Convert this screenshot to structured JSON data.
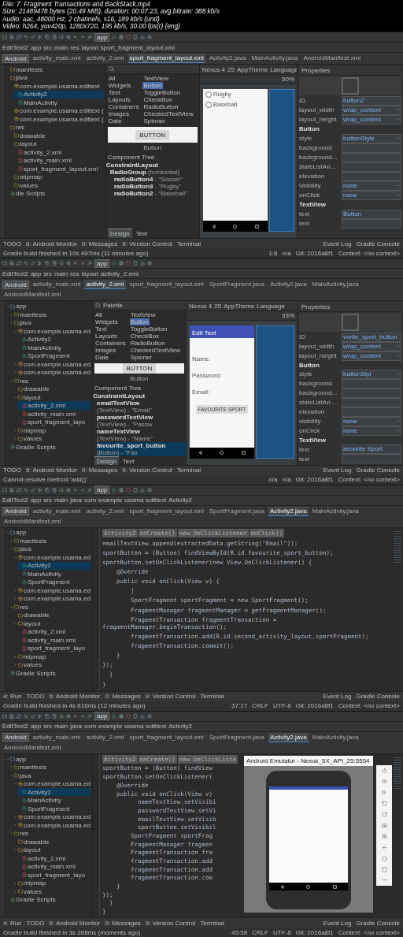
{
  "header": {
    "lines": [
      "File: 7. Fragment Transactions and BackStack.mp4",
      "Size: 21489478 bytes (20.49 MiB), duration: 00:07:23, avg.bitrate: 388 kb/s",
      "Audio: aac, 48000 Hz, 2 channels, s16, 189 kb/s (und)",
      "Video: h264, yuv420p, 1280x720, 195 kb/s, 30.00 fps(r) (eng)"
    ]
  },
  "frames": [
    {
      "kind": "designer",
      "run_config": "app",
      "breadcrumbs": [
        "EditText2",
        "app",
        "src",
        "main",
        "res",
        "layout",
        "sport_fragment_layout.xml"
      ],
      "view_mode": "Android",
      "tabs": [
        {
          "label": "activity_main.xml",
          "selected": false
        },
        {
          "label": "activity_2.xml",
          "selected": false
        },
        {
          "label": "sport_fragment_layout.xml",
          "selected": true
        },
        {
          "label": "Activity2.java",
          "selected": false
        },
        {
          "label": "MainActivity.java",
          "selected": false
        },
        {
          "label": "AndroidManifest.xml",
          "selected": false
        }
      ],
      "tree": [
        {
          "label": "manifests",
          "kind": "folder",
          "selected": false
        },
        {
          "label": "java",
          "kind": "folder",
          "selected": false,
          "children": [
            {
              "label": "com.example.usama.edittext",
              "kind": "package",
              "selected": false,
              "children": [
                {
                  "label": "Activity2",
                  "kind": "class",
                  "selected": true
                },
                {
                  "label": "MainActivity",
                  "kind": "class",
                  "selected": false
                }
              ]
            },
            {
              "label": "com.example.usama.edittext (",
              "kind": "package",
              "selected": false
            },
            {
              "label": "com.example.usama.edittext (",
              "kind": "package",
              "selected": false
            }
          ]
        },
        {
          "label": "res",
          "kind": "folder",
          "selected": false,
          "children": [
            {
              "label": "drawable",
              "kind": "folder",
              "selected": false
            },
            {
              "label": "layout",
              "kind": "folder",
              "selected": false,
              "children": [
                {
                  "label": "activity_2.xml",
                  "kind": "xml",
                  "selected": false
                },
                {
                  "label": "activity_main.xml",
                  "kind": "xml",
                  "selected": false
                },
                {
                  "label": "sport_fragment_layout.xml",
                  "kind": "xml",
                  "selected": false
                }
              ]
            },
            {
              "label": "mipmap",
              "kind": "folder",
              "selected": false
            },
            {
              "label": "values",
              "kind": "folder",
              "selected": false
            }
          ]
        },
        {
          "label": "dle Scripts",
          "kind": "gradle",
          "selected": false
        }
      ],
      "palette": {
        "categories": [
          "All",
          "Widgets",
          "Text",
          "Layouts",
          "Containers",
          "Images",
          "Date"
        ],
        "widgets": [
          {
            "label": "TextView",
            "selected": false
          },
          {
            "label": "Button",
            "selected": true
          },
          {
            "label": "ToggleButton",
            "selected": false
          },
          {
            "label": "CheckBox",
            "selected": false
          },
          {
            "label": "RadioButton",
            "selected": false
          },
          {
            "label": "CheckedTextView",
            "selected": false
          },
          {
            "label": "Spinner",
            "selected": false
          }
        ],
        "preview": "BUTTON",
        "caption": "Button"
      },
      "component_tree": {
        "title": "Component Tree",
        "nodes": [
          {
            "id": "ConstraintLayout",
            "selected": false,
            "children": [
              {
                "id": "RadioGroup",
                "detail": "(horizontal)",
                "selected": false,
                "children": [
                  {
                    "id": "radioButton4",
                    "detail": "- \"Soccer\"",
                    "selected": false
                  },
                  {
                    "id": "radioButton3",
                    "detail": "- \"Rugby\"",
                    "selected": false
                  },
                  {
                    "id": "radioButton2",
                    "detail": "- \"Baseball\"",
                    "selected": false
                  }
                ]
              }
            ]
          }
        ]
      },
      "design_tabs": [
        {
          "label": "Design",
          "selected": true
        },
        {
          "label": "Text",
          "selected": false
        }
      ],
      "canvas_toolbar": [
        "Nexus 4",
        "25",
        "AppTheme",
        "Language"
      ],
      "zoom": "50%",
      "screen": {
        "kind": "radios",
        "items": [
          {
            "label": "Rugby",
            "checked": false
          },
          {
            "label": "Baseball",
            "checked": false
          }
        ]
      },
      "properties_title": "Properties",
      "properties": [
        {
          "kind": "field",
          "label": "ID",
          "value": "button2"
        },
        {
          "kind": "dropdown",
          "label": "layout_width",
          "value": "wrap_content"
        },
        {
          "kind": "dropdown",
          "label": "layout_height",
          "value": "wrap_content"
        },
        {
          "kind": "header",
          "label": "Button"
        },
        {
          "kind": "dropdown",
          "label": "style",
          "value": "buttonStyle"
        },
        {
          "kind": "field",
          "label": "background"
        },
        {
          "kind": "field",
          "label": "background..."
        },
        {
          "kind": "field",
          "label": "stateListAn..."
        },
        {
          "kind": "field",
          "label": "elevation"
        },
        {
          "kind": "dropdown",
          "label": "visibility",
          "value": "none"
        },
        {
          "kind": "dropdown",
          "label": "onClick",
          "value": "none"
        },
        {
          "kind": "header",
          "label": "TextView"
        },
        {
          "kind": "field",
          "label": "text",
          "value": "Button"
        },
        {
          "kind": "field",
          "label": "text"
        }
      ],
      "tool_windows": [
        "TODO",
        "6: Android Monitor",
        "0: Messages",
        "9: Version Control",
        "Terminal"
      ],
      "tool_windows_right": [
        "Event Log",
        "Gradle Console"
      ],
      "status": {
        "message": "Gradle build finished in 10s 497ms (11 minutes ago)",
        "info": [
          "1:8",
          "n/a",
          "Git: 2016a8f1",
          "Context: <no context>"
        ]
      }
    },
    {
      "kind": "designer",
      "run_config": "app",
      "breadcrumbs": [
        "EditText2",
        "app",
        "src",
        "main",
        "res",
        "layout",
        "activity_2.xml"
      ],
      "view_mode": "Android",
      "tabs": [
        {
          "label": "activity_main.xml",
          "selected": false
        },
        {
          "label": "activity_2.xml",
          "selected": true
        },
        {
          "label": "sport_fragment_layout.xml",
          "selected": false
        },
        {
          "label": "SportFragment.java",
          "selected": false
        },
        {
          "label": "Activity2.java",
          "selected": false
        },
        {
          "label": "MainActivity.java",
          "selected": false
        },
        {
          "label": "AndroidManifest.xml",
          "selected": false
        }
      ],
      "tree": [
        {
          "label": "app",
          "kind": "module",
          "selected": false,
          "expanded": true,
          "children": [
            {
              "label": "manifests",
              "kind": "folder",
              "selected": false,
              "expanded": false
            },
            {
              "label": "java",
              "kind": "folder",
              "selected": false,
              "expanded": true,
              "children": [
                {
                  "label": "com.example.usama.ed",
                  "kind": "package",
                  "selected": false,
                  "expanded": true,
                  "children": [
                    {
                      "label": "Activity2",
                      "kind": "class",
                      "selected": false
                    },
                    {
                      "label": "MainActivity",
                      "kind": "class",
                      "selected": false
                    },
                    {
                      "label": "SportFragment",
                      "kind": "class",
                      "selected": false
                    }
                  ]
                },
                {
                  "label": "com.example.usama.ed",
                  "kind": "package",
                  "selected": false,
                  "expanded": false
                },
                {
                  "label": "com.example.usama.ed",
                  "kind": "package",
                  "selected": false,
                  "expanded": false
                }
              ]
            },
            {
              "label": "res",
              "kind": "folder",
              "selected": false,
              "expanded": true,
              "children": [
                {
                  "label": "drawable",
                  "kind": "folder",
                  "selected": false
                },
                {
                  "label": "layout",
                  "kind": "folder",
                  "selected": false,
                  "expanded": true,
                  "children": [
                    {
                      "label": "activity_2.xml",
                      "kind": "xml",
                      "selected": true
                    },
                    {
                      "label": "activity_main.xml",
                      "kind": "xml",
                      "selected": false
                    },
                    {
                      "label": "sport_fragment_layo",
                      "kind": "xml",
                      "selected": false
                    }
                  ]
                },
                {
                  "label": "mipmap",
                  "kind": "folder",
                  "selected": false,
                  "expanded": false
                },
                {
                  "label": "values",
                  "kind": "folder",
                  "selected": false,
                  "expanded": false
                }
              ]
            }
          ]
        },
        {
          "label": "Gradle Scripts",
          "kind": "gradle",
          "selected": false
        }
      ],
      "palette": {
        "title": "Palette",
        "categories": [
          "All",
          "Widgets",
          "Text",
          "Layouts",
          "Containers",
          "Images",
          "Date"
        ],
        "widgets": [
          {
            "label": "TextView",
            "selected": false
          },
          {
            "label": "Button",
            "selected": true
          },
          {
            "label": "ToggleButton",
            "selected": false
          },
          {
            "label": "CheckBox",
            "selected": false
          },
          {
            "label": "RadioButton",
            "selected": false
          },
          {
            "label": "CheckedTextView",
            "selected": false
          },
          {
            "label": "Spinner",
            "selected": false
          }
        ],
        "preview": "BUTTON",
        "caption": "Button"
      },
      "component_tree": {
        "title": "Component Tree",
        "nodes": [
          {
            "id": "ConstraintLayout",
            "selected": false,
            "children": [
              {
                "id": "emailTextView",
                "detail": "(TextView) - \"Email\"",
                "selected": false
              },
              {
                "id": "passwordTextView",
                "detail": "(TextView) - \"Passw",
                "selected": false
              },
              {
                "id": "nameTextView",
                "detail": "(TextView) - \"Name\"",
                "selected": false
              },
              {
                "id": "favourite_sport_button",
                "detail": "(Button) - \"Fav",
                "selected": true
              }
            ]
          }
        ]
      },
      "design_tabs": [
        {
          "label": "Design",
          "selected": true
        },
        {
          "label": "Text",
          "selected": false
        }
      ],
      "canvas_toolbar": [
        "Nexus 4",
        "25",
        "AppTheme",
        "Language"
      ],
      "zoom": "33%",
      "screen": {
        "kind": "form",
        "app_title": "Edit Text",
        "labels": [
          "Name:",
          "Password:",
          "Email:"
        ],
        "button": "FAVOURITE SPORT"
      },
      "properties_title": "Properties",
      "properties": [
        {
          "kind": "field",
          "label": "ID",
          "value": "vorite_sport_button"
        },
        {
          "kind": "dropdown",
          "label": "layout_width",
          "value": "wrap_content"
        },
        {
          "kind": "dropdown",
          "label": "layout_height",
          "value": "wrap_content"
        },
        {
          "kind": "header",
          "label": "Button"
        },
        {
          "kind": "dropdown",
          "label": "style",
          "value": "buttonStyl"
        },
        {
          "kind": "field",
          "label": "background"
        },
        {
          "kind": "field",
          "label": "background..."
        },
        {
          "kind": "field",
          "label": "stateListAn..."
        },
        {
          "kind": "field",
          "label": "elevation"
        },
        {
          "kind": "dropdown",
          "label": "visibility",
          "value": "none"
        },
        {
          "kind": "dropdown",
          "label": "onClick",
          "value": "none"
        },
        {
          "kind": "header",
          "label": "TextView"
        },
        {
          "kind": "field",
          "label": "text",
          "value": "avourite Sport"
        },
        {
          "kind": "field",
          "label": "text"
        }
      ],
      "tool_windows": [
        "TODO",
        "6: Android Monitor",
        "0: Messages",
        "9: Version Control",
        "Terminal"
      ],
      "tool_windows_right": [
        "Event Log",
        "Gradle Console"
      ],
      "status": {
        "message": "Cannot resolve method 'add()'",
        "info": [
          "n/a",
          "n/a",
          "Git: 2016a8f1",
          "Context: <no context>"
        ]
      }
    },
    {
      "kind": "code",
      "run_config": "app",
      "breadcrumbs": [
        "EditText2",
        "app",
        "src",
        "main",
        "java",
        "com",
        "example",
        "usama",
        "edittext",
        "Activity2"
      ],
      "view_mode": "Android",
      "tabs": [
        {
          "label": "activity_main.xml",
          "selected": false
        },
        {
          "label": "activity_2.xml",
          "selected": false
        },
        {
          "label": "sport_fragment_layout.xml",
          "selected": false
        },
        {
          "label": "SportFragment.java",
          "selected": false
        },
        {
          "label": "Activity2.java",
          "selected": true
        },
        {
          "label": "MainActivity.java",
          "selected": false
        },
        {
          "label": "AndroidManifest.xml",
          "selected": false
        }
      ],
      "tree": [
        {
          "label": "app",
          "kind": "module",
          "selected": false,
          "expanded": true,
          "children": [
            {
              "label": "manifests",
              "kind": "folder",
              "selected": false,
              "expanded": false
            },
            {
              "label": "java",
              "kind": "folder",
              "selected": false,
              "expanded": true,
              "children": [
                {
                  "label": "com.example.usama.ed",
                  "kind": "package",
                  "selected": false,
                  "expanded": true,
                  "children": [
                    {
                      "label": "Activity2",
                      "kind": "class",
                      "selected": true
                    },
                    {
                      "label": "MainActivity",
                      "kind": "class",
                      "selected": false
                    },
                    {
                      "label": "SportFragment",
                      "kind": "class",
                      "selected": false
                    }
                  ]
                },
                {
                  "label": "com.example.usama.ed",
                  "kind": "package",
                  "selected": false,
                  "expanded": false
                },
                {
                  "label": "com.example.usama.ed",
                  "kind": "package",
                  "selected": false,
                  "expanded": false
                }
              ]
            },
            {
              "label": "res",
              "kind": "folder",
              "selected": false,
              "expanded": true,
              "children": [
                {
                  "label": "drawable",
                  "kind": "folder",
                  "selected": false
                },
                {
                  "label": "layout",
                  "kind": "folder",
                  "selected": false,
                  "expanded": true,
                  "children": [
                    {
                      "label": "activity_2.xml",
                      "kind": "xml",
                      "selected": false
                    },
                    {
                      "label": "activity_main.xml",
                      "kind": "xml",
                      "selected": false
                    },
                    {
                      "label": "sport_fragment_layo",
                      "kind": "xml",
                      "selected": false
                    }
                  ]
                },
                {
                  "label": "mipmap",
                  "kind": "folder",
                  "selected": false,
                  "expanded": false
                },
                {
                  "label": "values",
                  "kind": "folder",
                  "selected": false,
                  "expanded": false
                }
              ]
            }
          ]
        },
        {
          "label": "Gradle Scripts",
          "kind": "gradle",
          "selected": false
        }
      ],
      "code_path": [
        "Activity2",
        "onCreate()",
        "new OnClickListener",
        "onClick()"
      ],
      "code": [
        "emailTextView.append(extractedData.getString(\"Email\"));",
        "sportButton = (Button) findViewById(R.id.favourite_sport_button);",
        "sportButton.setOnClickListener(new View.OnClickListener() {",
        "    @Override",
        "    public void onClick(View v) {",
        "        |",
        "        SportFragment sportFragment = new SportFragment();",
        "        FragmentManager fragmentManager = getFragmentManager();",
        "        FragmentTransaction fragmentTransaction = fragmentManager.beginTransaction();",
        "        fragmentTransaction.add(R.id.second_activity_layout,sportFragment);",
        "        fragmentTransaction.commit();",
        "    }",
        "});",
        "  }",
        "}"
      ],
      "tool_windows": [
        "4: Run",
        "TODO",
        "6: Android Monitor",
        "0: Messages",
        "9: Version Control",
        "Terminal"
      ],
      "tool_windows_right": [
        "Event Log",
        "Gradle Console"
      ],
      "status": {
        "message": "Gradle build finished in 4s 616ms (12 minutes ago)",
        "info": [
          "37:17",
          "CRLF",
          "UTF-8",
          "Git: 2016a8f1",
          "Context: <no context>"
        ]
      }
    },
    {
      "kind": "code",
      "run_config": "app",
      "breadcrumbs": [
        "EditText2",
        "app",
        "src",
        "main",
        "java",
        "com",
        "example",
        "usama",
        "edittext",
        "Activity2"
      ],
      "view_mode": "Android",
      "tabs": [
        {
          "label": "activity_main.xml",
          "selected": false
        },
        {
          "label": "activity_2.xml",
          "selected": false
        },
        {
          "label": "sport_fragment_layout.xml",
          "selected": false
        },
        {
          "label": "SportFragment.java",
          "selected": false
        },
        {
          "label": "Activity2.java",
          "selected": true
        },
        {
          "label": "MainActivity.java",
          "selected": false
        },
        {
          "label": "AndroidManifest.xml",
          "selected": false
        }
      ],
      "tree": [
        {
          "label": "app",
          "kind": "module",
          "selected": false,
          "expanded": true,
          "children": [
            {
              "label": "manifests",
              "kind": "folder",
              "selected": false,
              "expanded": false
            },
            {
              "label": "java",
              "kind": "folder",
              "selected": false,
              "expanded": true,
              "children": [
                {
                  "label": "com.example.usama.ed",
                  "kind": "package",
                  "selected": false,
                  "expanded": true,
                  "children": [
                    {
                      "label": "Activity2",
                      "kind": "class",
                      "selected": true
                    },
                    {
                      "label": "MainActivity",
                      "kind": "class",
                      "selected": false
                    },
                    {
                      "label": "SportFragment",
                      "kind": "class",
                      "selected": false
                    }
                  ]
                },
                {
                  "label": "com.example.usama.ed",
                  "kind": "package",
                  "selected": false,
                  "expanded": false
                },
                {
                  "label": "com.example.usama.ed",
                  "kind": "package",
                  "selected": false,
                  "expanded": false
                }
              ]
            },
            {
              "label": "res",
              "kind": "folder",
              "selected": false,
              "expanded": true,
              "children": [
                {
                  "label": "drawable",
                  "kind": "folder",
                  "selected": false
                },
                {
                  "label": "layout",
                  "kind": "folder",
                  "selected": false,
                  "expanded": true,
                  "children": [
                    {
                      "label": "activity_2.xml",
                      "kind": "xml",
                      "selected": false
                    },
                    {
                      "label": "activity_main.xml",
                      "kind": "xml",
                      "selected": false
                    },
                    {
                      "label": "sport_fragment_layo",
                      "kind": "xml",
                      "selected": false
                    }
                  ]
                },
                {
                  "label": "mipmap",
                  "kind": "folder",
                  "selected": false,
                  "expanded": false
                },
                {
                  "label": "values",
                  "kind": "folder",
                  "selected": false,
                  "expanded": false
                }
              ]
            }
          ]
        },
        {
          "label": "Gradle Scripts",
          "kind": "gradle",
          "selected": false
        }
      ],
      "code_path": [
        "Activity2",
        "onCreate()",
        "new OnClickListe"
      ],
      "code": [
        "sportButton = (Button) findView",
        "sportButton.setOnClickListener(",
        "    @Override",
        "    public void onClick(View v)",
        "          nameTextView.setVisibi",
        "          passwordTextView.setVi",
        "          emailTextView.setVisib",
        "          sportButton.setVisibil",
        "        SportFragment sportFrag",
        "        FragmentManager fragmen",
        "        FragmentTransaction fra",
        "        fragmentTransaction.add",
        "        fragmentTransaction.add",
        "        fragmentTransaction.com",
        "    }",
        "});",
        "  }",
        "}"
      ],
      "emulator": {
        "title": "Android Emulator - Nexus_5X_API_25:5554"
      },
      "tool_windows": [
        "4: Run",
        "TODO",
        "6: Android Monitor",
        "0: Messages",
        "9: Version Control",
        "Terminal"
      ],
      "tool_windows_right": [
        "Event Log",
        "Gradle Console"
      ],
      "status": {
        "message": "Gradle build finished in 3s 266ms (moments ago)",
        "info": [
          "45:58",
          "CRLF",
          "UTF-8",
          "Git: 2016a8f1",
          "Context: <no context>"
        ]
      }
    }
  ]
}
